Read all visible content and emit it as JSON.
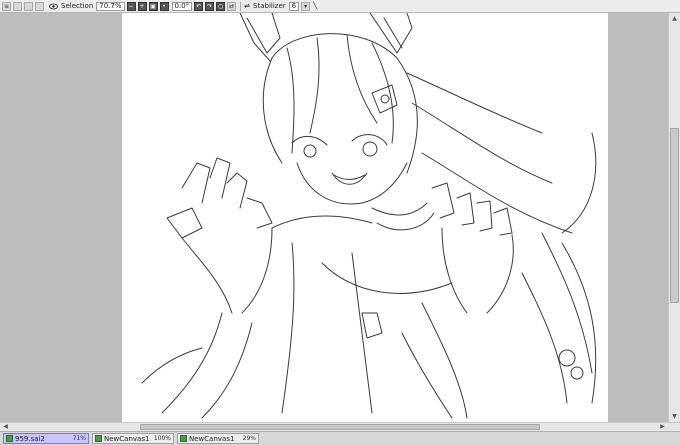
{
  "toolbar": {
    "selection_label": "Selection",
    "zoom_value": "70.7%",
    "rotation_value": "0.0°",
    "stabilizer_label": "Stabilizer",
    "stabilizer_value": "6"
  },
  "tabs": [
    {
      "name": "959.sai2",
      "zoom": "71%",
      "active": true
    },
    {
      "name": "NewCanvas1",
      "zoom": "100%",
      "active": false
    },
    {
      "name": "NewCanvas1",
      "zoom": "29%",
      "active": false
    }
  ],
  "colors": {
    "active_tab": "#c9c3ff",
    "canvas": "#ffffff",
    "workspace": "#bdbdbd"
  }
}
